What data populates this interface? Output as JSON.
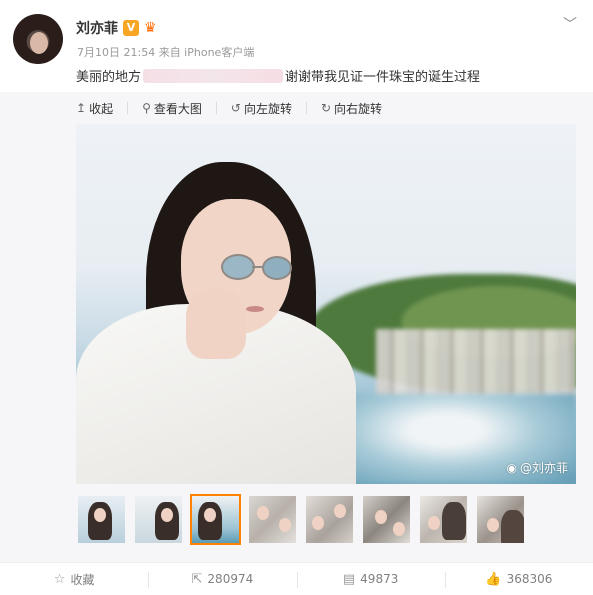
{
  "post": {
    "author": "刘亦菲",
    "verified_badge": "V",
    "meta": "7月10日 21:54 来自 iPhone客户端",
    "caption_before": "美丽的地方",
    "caption_after": "谢谢带我见证一件珠宝的诞生过程"
  },
  "toolbar": {
    "collapse": "收起",
    "view_large": "查看大图",
    "rotate_left": "向左旋转",
    "rotate_right": "向右旋转"
  },
  "photo": {
    "watermark": "@刘亦菲"
  },
  "thumbnails": [
    {
      "state": "normal"
    },
    {
      "state": "normal"
    },
    {
      "state": "active"
    },
    {
      "state": "normal"
    },
    {
      "state": "normal"
    },
    {
      "state": "normal"
    },
    {
      "state": "normal"
    },
    {
      "state": "normal"
    }
  ],
  "footer": {
    "favorite": "收藏",
    "reposts": "280974",
    "comments": "49873",
    "likes": "368306"
  },
  "icons": {
    "collapse": "arrow-up-icon",
    "view_large": "magnifier-icon",
    "rotate_left": "rotate-left-icon",
    "rotate_right": "rotate-right-icon",
    "favorite": "star-icon",
    "repost": "repost-icon",
    "comment": "comment-icon",
    "like": "thumbs-up-icon"
  },
  "colors": {
    "accent": "#ff8200",
    "verified": "#f6a623"
  }
}
